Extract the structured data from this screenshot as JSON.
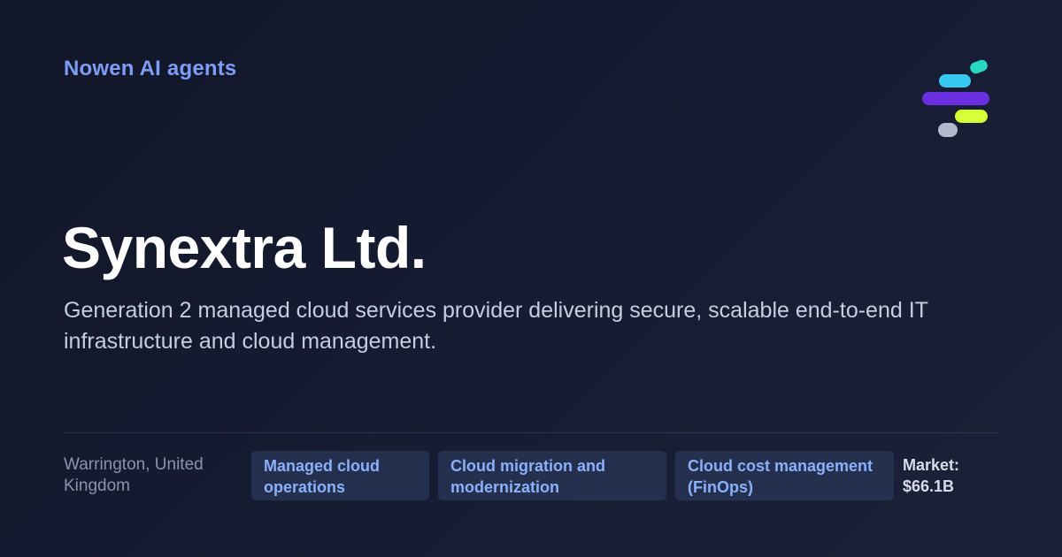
{
  "brand": {
    "name": "Nowen AI agents",
    "logo_colors": [
      "#28d7c0",
      "#38c8f0",
      "#6a2fe0",
      "#d6ff3a",
      "#b4b8cc"
    ]
  },
  "company": {
    "name": "Synextra Ltd.",
    "description": "Generation 2 managed cloud services provider delivering secure, scalable end-to-end IT infrastructure and cloud management."
  },
  "footer": {
    "location": "Warrington, United Kingdom",
    "tags": [
      {
        "label": "Managed cloud operations"
      },
      {
        "label": "Cloud migration and modernization"
      },
      {
        "label": "Cloud cost management (FinOps)"
      }
    ],
    "market_label": "Market:",
    "market_value": "$66.1B"
  },
  "colors": {
    "accent": "#7c9cf5",
    "tag_background": "#252f4e",
    "tag_text": "#8ab1fb",
    "background": "#141a2e"
  }
}
